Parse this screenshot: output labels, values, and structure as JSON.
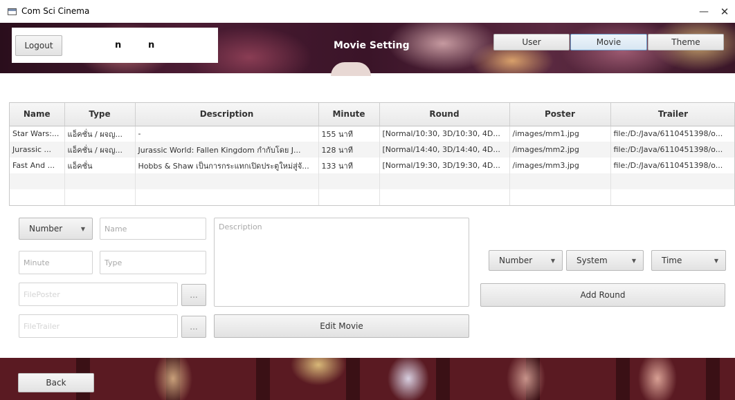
{
  "window": {
    "title": "Com Sci Cinema",
    "minimize_glyph": "—",
    "maximize_glyph": "☐",
    "close_glyph": "✕"
  },
  "header": {
    "logout_label": "Logout",
    "user_first": "n",
    "user_last": "n",
    "page_title": "Movie Setting",
    "nav": {
      "user": "User",
      "movie": "Movie",
      "theme": "Theme"
    }
  },
  "table": {
    "columns": [
      "Name",
      "Type",
      "Description",
      "Minute",
      "Round",
      "Poster",
      "Trailer"
    ],
    "rows": [
      [
        "Star Wars:...",
        "แอ็คชั่น / ผจญ...",
        "-",
        "155 นาที",
        "[Normal/10:30, 3D/10:30, 4D...",
        "/images/mm1.jpg",
        "file:/D:/Java/6110451398/o..."
      ],
      [
        "Jurassic ...",
        "แอ็คชั่น / ผจญ...",
        "Jurassic World: Fallen Kingdom กำกับโดย J...",
        "128 นาที",
        "[Normal/14:40, 3D/14:40, 4D...",
        "/images/mm2.jpg",
        "file:/D:/Java/6110451398/o..."
      ],
      [
        "Fast And ...",
        "แอ็คชั่น",
        "Hobbs & Shaw เป็นการกระแทกเปิดประตูใหม่สู่จั...",
        "133 นาที",
        "[Normal/19:30, 3D/19:30, 4D...",
        "/images/mm3.jpg",
        "file:/D:/Java/6110451398/o..."
      ]
    ]
  },
  "form": {
    "number_select": "Number",
    "name_placeholder": "Name",
    "minute_placeholder": "Minute",
    "type_placeholder": "Type",
    "fileposter_placeholder": "FilePoster",
    "filetrailer_placeholder": "FileTrailer",
    "browse_label": "...",
    "description_placeholder": "Description",
    "edit_movie_label": "Edit Movie",
    "round_number_select": "Number",
    "system_select": "System",
    "time_select": "Time",
    "add_round_label": "Add Round"
  },
  "footer": {
    "back_label": "Back"
  }
}
